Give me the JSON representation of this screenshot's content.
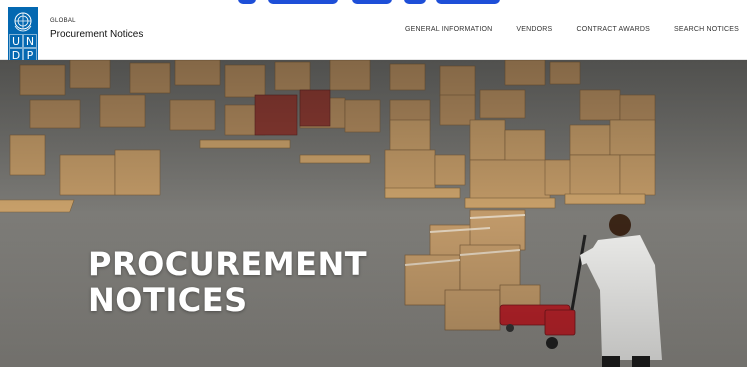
{
  "header": {
    "logo": {
      "icon": "un-emblem-icon",
      "letters": [
        "U",
        "N",
        "D",
        "P"
      ],
      "brand_color": "#0468b1"
    },
    "site_eyebrow": "GLOBAL",
    "site_name": "Procurement Notices"
  },
  "nav": {
    "items": [
      {
        "label": "GENERAL INFORMATION"
      },
      {
        "label": "VENDORS"
      },
      {
        "label": "CONTRACT AWARDS"
      },
      {
        "label": "SEARCH NOTICES"
      }
    ]
  },
  "hero": {
    "title_line1": "PROCUREMENT",
    "title_line2": "NOTICES",
    "image": "warehouse-with-boxes-and-pallet-jack"
  },
  "colors": {
    "accent": "#1e4fd8",
    "hero_text": "#ffffff"
  }
}
